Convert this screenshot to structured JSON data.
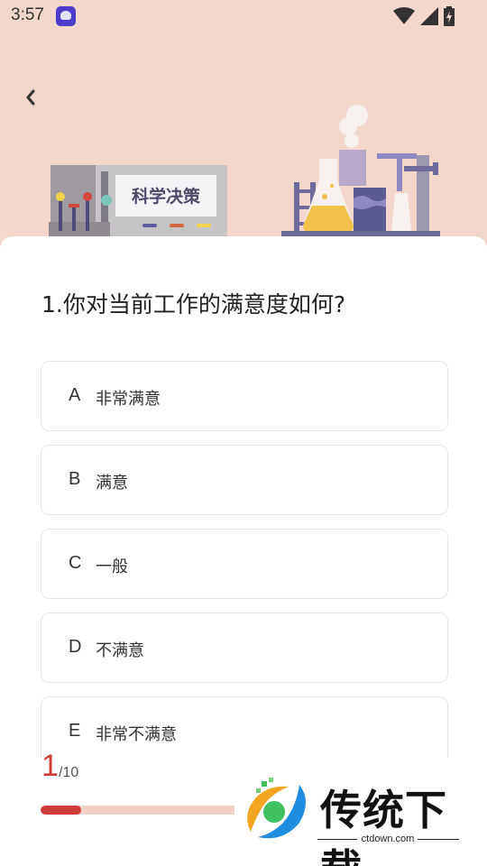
{
  "status_bar": {
    "time": "3:57"
  },
  "hero": {
    "sign_text": "科学决策"
  },
  "question": {
    "title": "1.你对当前工作的满意度如何?"
  },
  "options": [
    {
      "letter": "A",
      "text": "非常满意"
    },
    {
      "letter": "B",
      "text": "满意"
    },
    {
      "letter": "C",
      "text": "一般"
    },
    {
      "letter": "D",
      "text": "不满意"
    },
    {
      "letter": "E",
      "text": "非常不满意"
    }
  ],
  "progress": {
    "current": "1",
    "total": "/10",
    "fraction": 0.1
  },
  "watermark": {
    "title": "传统下载",
    "url": "ctdown.com"
  },
  "colors": {
    "background": "#f3d6cc",
    "accent": "#cf3d3a",
    "progress_track": "#f4d1c8"
  }
}
